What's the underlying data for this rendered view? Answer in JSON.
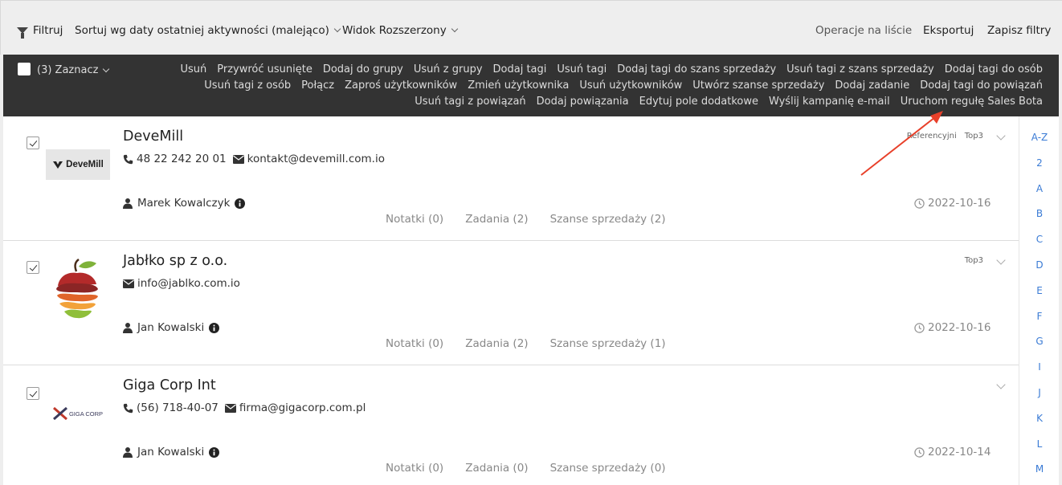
{
  "filterbar": {
    "filter_label": "Filtruj",
    "sort_label": "Sortuj wg daty ostatniej aktywności (malejąco)",
    "view_label": "Widok Rozszerzony",
    "list_ops_label": "Operacje na liście",
    "export_label": "Eksportuj",
    "save_filters_label": "Zapisz filtry"
  },
  "actionbar": {
    "select_label": "(3) Zaznacz",
    "row1": [
      "Usuń",
      "Przywróć usunięte",
      "Dodaj do grupy",
      "Usuń z grupy",
      "Dodaj tagi",
      "Usuń tagi",
      "Dodaj tagi do szans sprzedaży",
      "Usuń tagi z szans sprzedaży",
      "Dodaj tagi do osób"
    ],
    "row2": [
      "Usuń tagi z osób",
      "Połącz",
      "Zaproś użytkowników",
      "Zmień użytkownika",
      "Usuń użytkowników",
      "Utwórz szanse sprzedaży",
      "Dodaj zadanie",
      "Dodaj tagi do powiązań"
    ],
    "row3": [
      "Usuń tagi z powiązań",
      "Dodaj powiązania",
      "Edytuj pole dodatkowe",
      "Wyślij kampanię e-mail",
      "Uruchom regułę Sales Bota"
    ]
  },
  "companies": [
    {
      "name": "DeveMill",
      "logo_text": "DeveMill",
      "phone": "48 22 242 20 01",
      "email": "kontakt@devemill.com.io",
      "owner": "Marek Kowalczyk",
      "date": "2022-10-16",
      "notes": "Notatki (0)",
      "tasks": "Zadania (2)",
      "deals": "Szanse sprzedaży (2)",
      "tags": [
        "Referencyjni",
        "Top3"
      ]
    },
    {
      "name": "Jabłko sp z o.o.",
      "logo_text": "",
      "phone": "",
      "email": "info@jablko.com.io",
      "owner": "Jan Kowalski",
      "date": "2022-10-16",
      "notes": "Notatki (0)",
      "tasks": "Zadania (2)",
      "deals": "Szanse sprzedaży (1)",
      "tags": [
        "Top3"
      ]
    },
    {
      "name": "Giga Corp Int",
      "logo_text": "GIGA CORP",
      "phone": "(56) 718-40-07",
      "email": "firma@gigacorp.com.pl",
      "owner": "Jan Kowalski",
      "date": "2022-10-14",
      "notes": "Notatki (0)",
      "tasks": "Zadania (0)",
      "deals": "Szanse sprzedaży (0)",
      "tags": []
    }
  ],
  "alphabet": [
    "A-Z",
    "2",
    "A",
    "B",
    "C",
    "D",
    "E",
    "F",
    "G",
    "I",
    "J",
    "K",
    "L",
    "M"
  ],
  "colors": {
    "accent_link": "#3a7bd5",
    "action_bar_bg": "#333333",
    "annotation_arrow": "#e8402a"
  }
}
